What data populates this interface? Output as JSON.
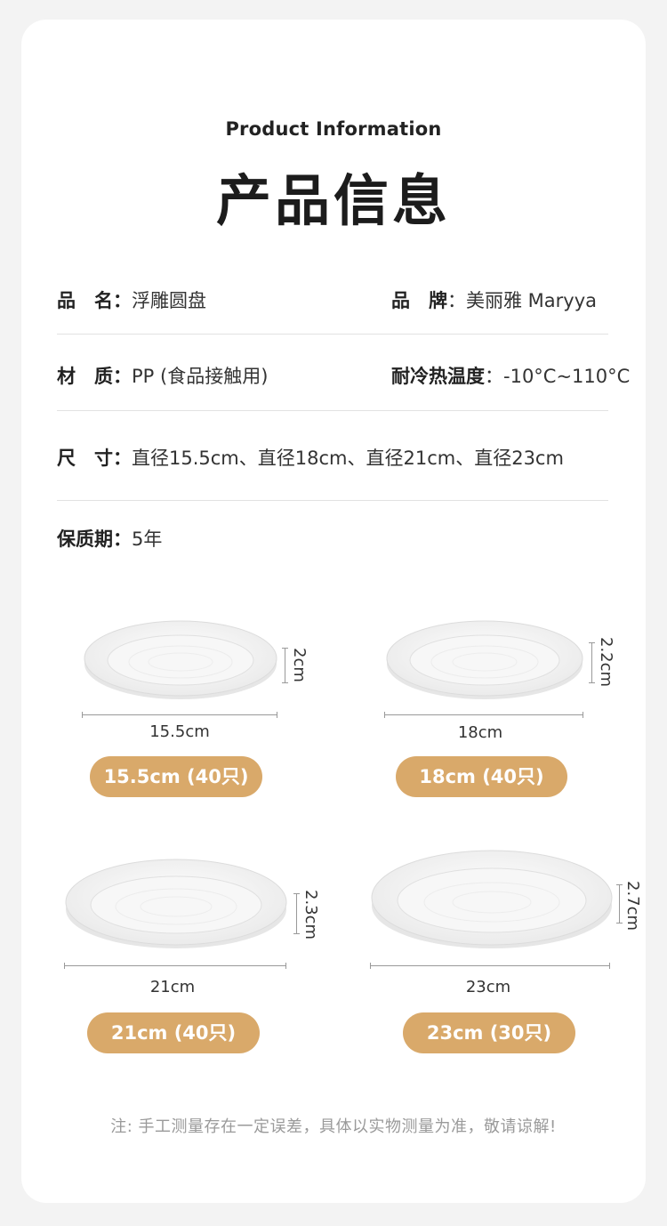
{
  "header": {
    "subtitle": "Product Information",
    "title": "产品信息"
  },
  "specs": {
    "name_key": "品　名",
    "name_value": "浮雕圆盘",
    "brand_key": "品　牌",
    "brand_value": "美丽雅 Maryya",
    "material_key": "材　质",
    "material_value": "PP (食品接触用)",
    "temp_key": "耐冷热温度",
    "temp_value": "-10°C~110°C",
    "size_key": "尺　寸",
    "size_value": "直径15.5cm、直径18cm、直径21cm、直径23cm",
    "shelf_key": "保质期",
    "shelf_value": "5年",
    "colon": "："
  },
  "plates": [
    {
      "width_label": "15.5cm",
      "height_label": "2cm",
      "pill": "15.5cm (40只)"
    },
    {
      "width_label": "18cm",
      "height_label": "2.2cm",
      "pill": "18cm (40只)"
    },
    {
      "width_label": "21cm",
      "height_label": "2.3cm",
      "pill": "21cm (40只)"
    },
    {
      "width_label": "23cm",
      "height_label": "2.7cm",
      "pill": "23cm (30只)"
    }
  ],
  "note": "注: 手工测量存在一定误差，具体以实物测量为准，敬请谅解!",
  "colors": {
    "accent": "#d9a96a",
    "background": "#f3f3f3",
    "card": "#ffffff"
  }
}
